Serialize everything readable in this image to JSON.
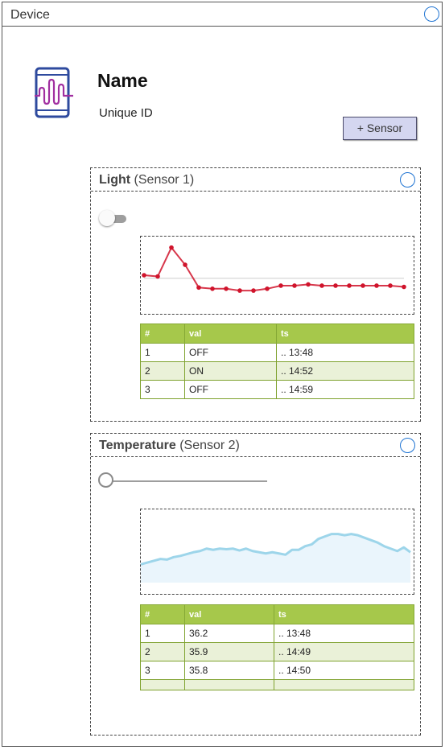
{
  "window": {
    "title": "Device"
  },
  "device": {
    "name": "Name",
    "unique_id": "Unique ID",
    "add_sensor_label": "+ Sensor",
    "icon": "device-signal-icon"
  },
  "colors": {
    "accent": "#1e73d2",
    "table_header": "#a6c84b",
    "table_row_alt": "#eaf1d8",
    "light_line": "#d0142c",
    "temp_line": "#9dd5ea",
    "temp_fill": "#eaf5fc"
  },
  "sensors": [
    {
      "name": "Light",
      "suffix": "(Sensor 1)",
      "control": {
        "type": "toggle",
        "state": "off"
      },
      "table": {
        "headers": [
          "#",
          "val",
          "ts"
        ],
        "rows": [
          [
            "1",
            "OFF",
            ".. 13:48"
          ],
          [
            "2",
            "ON",
            ".. 14:52"
          ],
          [
            "3",
            "OFF",
            ".. 14:59"
          ]
        ]
      }
    },
    {
      "name": "Temperature",
      "suffix": "(Sensor 2)",
      "control": {
        "type": "slider",
        "value": 0
      },
      "table": {
        "headers": [
          "#",
          "val",
          "ts"
        ],
        "rows": [
          [
            "1",
            "36.2",
            ".. 13:48"
          ],
          [
            "2",
            "35.9",
            ".. 14:49"
          ],
          [
            "3",
            "35.8",
            ".. 14:50"
          ],
          [
            "",
            "",
            ""
          ]
        ]
      }
    }
  ],
  "chart_data": [
    {
      "type": "line",
      "series": [
        {
          "values": [
            0.55,
            0.53,
            1.0,
            0.72,
            0.35,
            0.33,
            0.33,
            0.3,
            0.3,
            0.33,
            0.38,
            0.38,
            0.4,
            0.38,
            0.38,
            0.38,
            0.38,
            0.38,
            0.38,
            0.36
          ]
        }
      ],
      "ylim": [
        0,
        1.1
      ],
      "baseline": 0.5,
      "grid": false
    },
    {
      "type": "area",
      "series": [
        {
          "values": [
            0.3,
            0.33,
            0.36,
            0.39,
            0.38,
            0.42,
            0.44,
            0.47,
            0.5,
            0.52,
            0.56,
            0.54,
            0.56,
            0.55,
            0.56,
            0.53,
            0.56,
            0.52,
            0.5,
            0.48,
            0.5,
            0.48,
            0.46,
            0.54,
            0.54,
            0.6,
            0.63,
            0.72,
            0.76,
            0.8,
            0.8,
            0.78,
            0.8,
            0.78,
            0.74,
            0.7,
            0.66,
            0.6,
            0.56,
            0.52,
            0.58,
            0.5
          ]
        }
      ],
      "ylim": [
        0,
        1.1
      ],
      "grid": false
    }
  ]
}
